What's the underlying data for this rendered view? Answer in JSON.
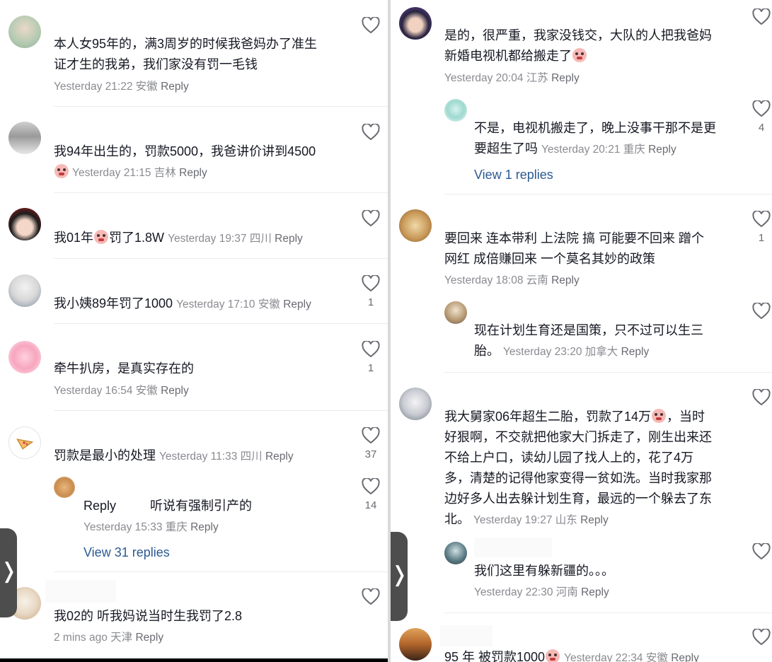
{
  "left": {
    "comments": [
      {
        "text_lines": [
          "本人女95年的，满3周岁的时候我爸妈办了准生",
          "证才生的我弟，我们家没有罚一毛钱"
        ],
        "meta": "Yesterday 21:22 安徽",
        "reply": "Reply",
        "likes": ""
      },
      {
        "text": "我94年出生的，罚款5000，我爸讲价讲到4500",
        "meta": "Yesterday 21:15 吉林",
        "reply": "Reply",
        "likes": "",
        "emoji": "crying-emoji"
      },
      {
        "text_before": "我01年",
        "text_after": "罚了1.8W",
        "meta": "Yesterday 19:37 四川",
        "reply": "Reply",
        "likes": "",
        "emoji": "crying-emoji"
      },
      {
        "text": "我小姨89年罚了1000",
        "meta": "Yesterday 17:10 安徽",
        "reply": "Reply",
        "likes": "1"
      },
      {
        "text": "牵牛扒房，是真实存在的",
        "meta": "Yesterday 16:54 安徽",
        "reply": "Reply",
        "likes": "1"
      },
      {
        "text": "罚款是最小的处理",
        "meta": "Yesterday 11:33 四川",
        "reply": "Reply",
        "likes": "37"
      },
      {
        "reply_label": "Reply",
        "text": "听说有强制引产的",
        "meta": "Yesterday 15:33 重庆",
        "reply": "Reply",
        "likes": "14"
      },
      {
        "text": "我02的 听我妈说当时生我罚了2.8",
        "meta": "2 mins ago 天津",
        "reply": "Reply",
        "likes": ""
      }
    ],
    "view_replies": "View 31 replies",
    "edge_tab": "❭"
  },
  "right": {
    "comments": [
      {
        "text_lines": [
          "是的，很严重，我家没钱交，大队的人把我爸妈",
          "新婚电视机都给搬走了"
        ],
        "meta": "Yesterday 20:04 江苏",
        "reply": "Reply",
        "likes": "",
        "emoji": "crying-emoji"
      },
      {
        "text_lines": [
          "不是，电视机搬走了，晚上没事干那不是更",
          "要超生了吗"
        ],
        "meta": "Yesterday 20:21 重庆",
        "reply": "Reply",
        "likes": "4"
      },
      {
        "text_lines": [
          "要回来  连本带利  上法院  搞  可能要不回来  蹭个",
          "网红  成倍赚回来  一个莫名其妙的政策"
        ],
        "meta": "Yesterday 18:08 云南",
        "reply": "Reply",
        "likes": "1"
      },
      {
        "text_lines": [
          "现在计划生育还是国策，只不过可以生三",
          "胎。"
        ],
        "meta": "Yesterday 23:20 加拿大",
        "reply": "Reply",
        "likes": ""
      },
      {
        "text_lines": [
          "我大舅家06年超生二胎，罚款了14万",
          "，当时",
          "好狠啊，不交就把他家大门拆走了，刚生出来还",
          "不给上户口，读幼儿园了找人上的，花了4万",
          "多，清楚的记得他家变得一贫如洗。当时我家那",
          "边好多人出去躲计划生育，最远的一个躲去了东",
          "北。"
        ],
        "meta": "Yesterday 19:27 山东",
        "reply": "Reply",
        "likes": "",
        "emoji": "crying-emoji"
      },
      {
        "text": "我们这里有躲新疆的。。。",
        "meta": "Yesterday 22:30 河南",
        "reply": "Reply",
        "likes": ""
      },
      {
        "text": "95 年 被罚款1000",
        "meta": "Yesterday 22:34 安徽",
        "reply": "Reply",
        "likes": "",
        "emoji": "crying-emoji"
      }
    ],
    "view_replies": "View 1 replies",
    "edge_tab": "❭"
  },
  "colors": {
    "text": "#161823",
    "meta": "#8a8b91",
    "link": "#2b5a92",
    "divider": "#ededed"
  }
}
